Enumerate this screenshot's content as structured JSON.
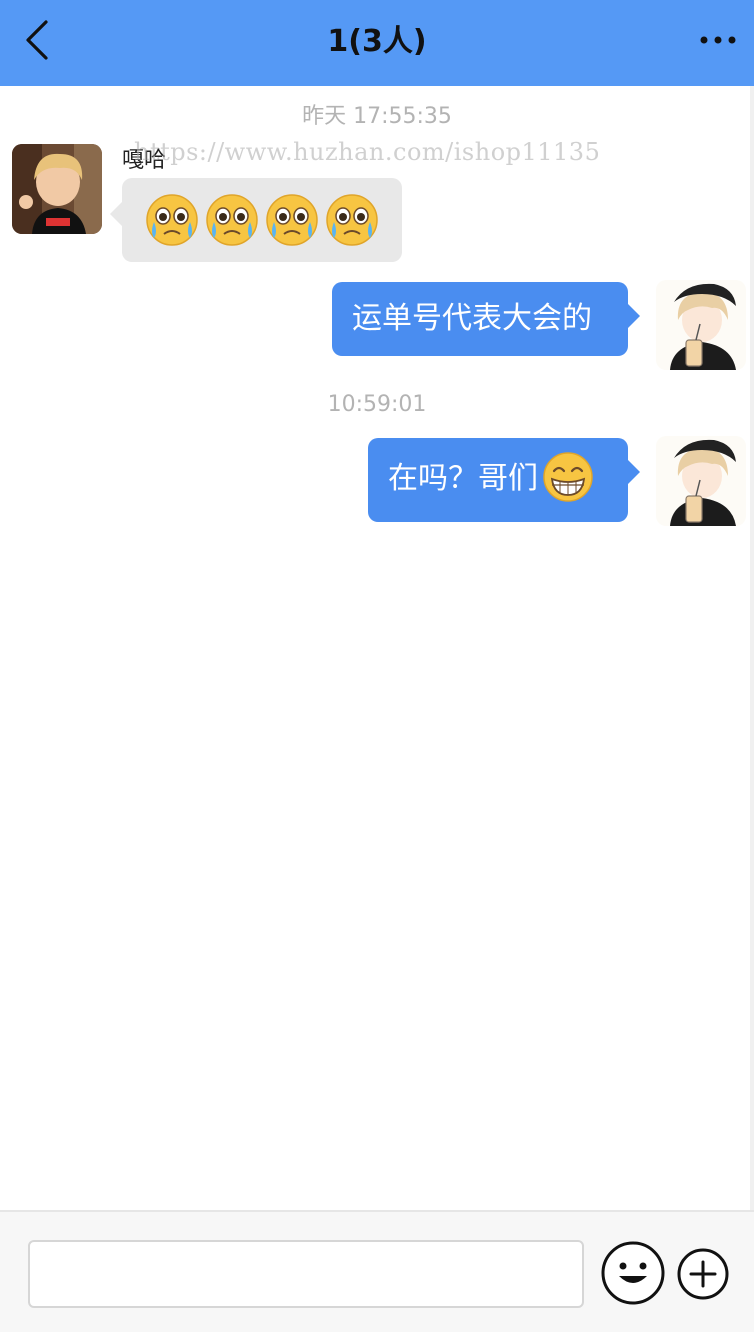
{
  "header": {
    "title": "1(3人)",
    "back_icon": "chevron-left-icon",
    "more_icon": "more-dots-icon",
    "background_color": "#5599f5"
  },
  "messages": {
    "timestamp_1": "昨天 17:55:35",
    "msg_1": {
      "sender": "嘎哈",
      "emojis": [
        "crying-face-icon",
        "crying-face-icon",
        "crying-face-icon",
        "crying-face-icon"
      ]
    },
    "msg_2": {
      "text": "运单号代表大会的"
    },
    "timestamp_2": "10:59:01",
    "msg_3": {
      "text": "在吗？哥们",
      "emoji": "grinning-face-icon"
    }
  },
  "watermark": "https://www.huzhan.com/ishop11135",
  "input_bar": {
    "placeholder": "",
    "emoji_button_icon": "smiley-icon",
    "plus_button_icon": "plus-circle-icon"
  },
  "colors": {
    "my_bubble": "#4a8df0",
    "other_bubble": "#e8e8e8",
    "timestamp_text": "#b3b3b3"
  }
}
